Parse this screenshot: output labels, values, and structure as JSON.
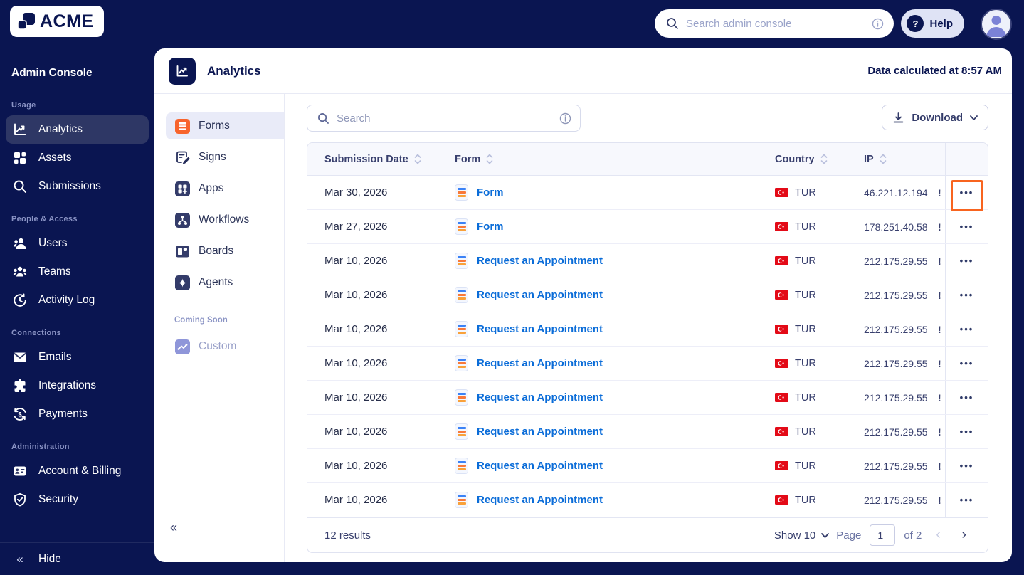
{
  "colors": {
    "navy": "#0a1551",
    "accent_orange": "#f8641f",
    "link_blue": "#0a6cd8",
    "flag_red": "#e30a17",
    "sidebar_active": "#2e3765",
    "nav_active_bg": "#e9ebf8"
  },
  "topbar": {
    "logo_text": "ACME",
    "search_placeholder": "Search admin console",
    "help_label": "Help"
  },
  "sidebar": {
    "title": "Admin Console",
    "sections": [
      {
        "label": "Usage",
        "items": [
          {
            "label": "Analytics",
            "icon": "analytics-icon",
            "active": true
          },
          {
            "label": "Assets",
            "icon": "assets-icon"
          },
          {
            "label": "Submissions",
            "icon": "submissions-search-icon"
          }
        ]
      },
      {
        "label": "People & Access",
        "items": [
          {
            "label": "Users",
            "icon": "users-icon"
          },
          {
            "label": "Teams",
            "icon": "teams-icon"
          },
          {
            "label": "Activity Log",
            "icon": "activity-log-icon"
          }
        ]
      },
      {
        "label": "Connections",
        "items": [
          {
            "label": "Emails",
            "icon": "emails-icon"
          },
          {
            "label": "Integrations",
            "icon": "integrations-icon"
          },
          {
            "label": "Payments",
            "icon": "payments-icon"
          }
        ]
      },
      {
        "label": "Administration",
        "items": [
          {
            "label": "Account & Billing",
            "icon": "account-billing-icon"
          },
          {
            "label": "Security",
            "icon": "security-icon"
          }
        ]
      }
    ],
    "hide_label": "Hide"
  },
  "page": {
    "title": "Analytics",
    "calculated_text": "Data calculated at 8:57 AM"
  },
  "product_nav": {
    "items": [
      {
        "label": "Forms",
        "active": true
      },
      {
        "label": "Signs"
      },
      {
        "label": "Apps"
      },
      {
        "label": "Workflows"
      },
      {
        "label": "Boards"
      },
      {
        "label": "Agents"
      }
    ],
    "coming_soon_label": "Coming Soon",
    "coming_soon_item": "Custom"
  },
  "toolbar": {
    "search_placeholder": "Search",
    "download_label": "Download"
  },
  "table": {
    "columns": {
      "date": "Submission Date",
      "form": "Form",
      "country": "Country",
      "ip": "IP"
    },
    "rows": [
      {
        "date": "Mar 30, 2026",
        "form": "Form",
        "country": "TUR",
        "ip": "46.221.12.194",
        "clipped": "!"
      },
      {
        "date": "Mar 27, 2026",
        "form": "Form",
        "country": "TUR",
        "ip": "178.251.40.58",
        "clipped": "!"
      },
      {
        "date": "Mar 10, 2026",
        "form": "Request an Appointment",
        "country": "TUR",
        "ip": "212.175.29.55",
        "clipped": "!"
      },
      {
        "date": "Mar 10, 2026",
        "form": "Request an Appointment",
        "country": "TUR",
        "ip": "212.175.29.55",
        "clipped": "!"
      },
      {
        "date": "Mar 10, 2026",
        "form": "Request an Appointment",
        "country": "TUR",
        "ip": "212.175.29.55",
        "clipped": "!"
      },
      {
        "date": "Mar 10, 2026",
        "form": "Request an Appointment",
        "country": "TUR",
        "ip": "212.175.29.55",
        "clipped": "!"
      },
      {
        "date": "Mar 10, 2026",
        "form": "Request an Appointment",
        "country": "TUR",
        "ip": "212.175.29.55",
        "clipped": "!"
      },
      {
        "date": "Mar 10, 2026",
        "form": "Request an Appointment",
        "country": "TUR",
        "ip": "212.175.29.55",
        "clipped": "!"
      },
      {
        "date": "Mar 10, 2026",
        "form": "Request an Appointment",
        "country": "TUR",
        "ip": "212.175.29.55",
        "clipped": "!"
      },
      {
        "date": "Mar 10, 2026",
        "form": "Request an Appointment",
        "country": "TUR",
        "ip": "212.175.29.55",
        "clipped": "!"
      }
    ],
    "kebab_glyph": "•••"
  },
  "footer": {
    "results_text": "12 results",
    "show_label": "Show 10",
    "page_label": "Page",
    "page_value": "1",
    "of_label": "of 2",
    "prev_glyph": "‹",
    "next_glyph": "›"
  }
}
